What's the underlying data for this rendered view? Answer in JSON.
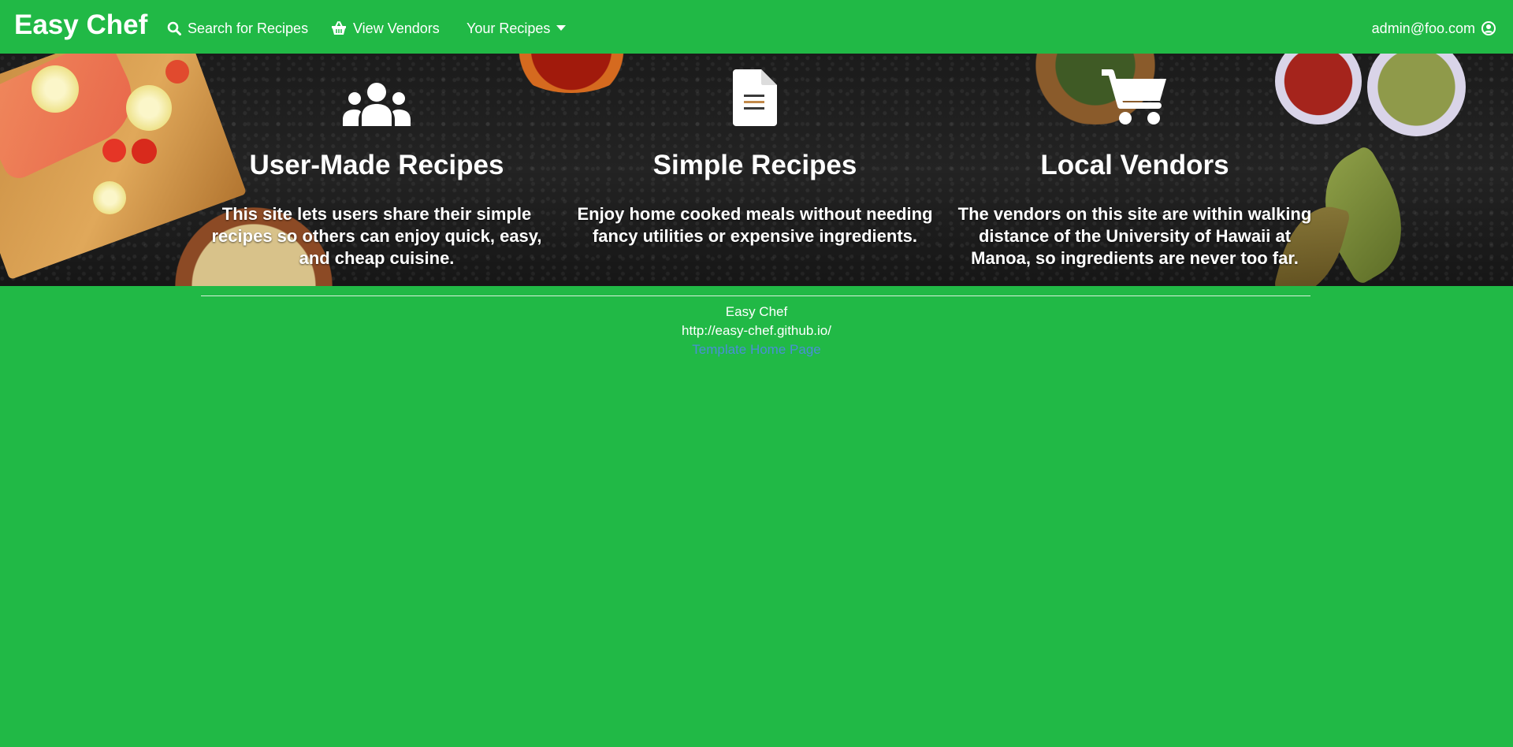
{
  "navbar": {
    "brand": "Easy Chef",
    "items": [
      {
        "label": "Search for Recipes",
        "icon": "search-icon"
      },
      {
        "label": "View Vendors",
        "icon": "basket-icon"
      },
      {
        "label": "Your Recipes",
        "icon": "caret-down-icon"
      }
    ],
    "user": {
      "label": "admin@foo.com",
      "icon": "user-circle-icon"
    }
  },
  "features": [
    {
      "icon": "users-icon",
      "title": "User-Made Recipes",
      "text": "This site lets users share their simple recipes so others can enjoy quick, easy, and cheap cuisine."
    },
    {
      "icon": "file-document-icon",
      "title": "Simple Recipes",
      "text": "Enjoy home cooked meals without needing fancy utilities or expensive ingredients."
    },
    {
      "icon": "shopping-cart-icon",
      "title": "Local Vendors",
      "text": "The vendors on this site are within walking distance of the University of Hawaii at Manoa, so ingredients are never too far."
    }
  ],
  "footer": {
    "name": "Easy Chef",
    "url": "http://easy-chef.github.io/",
    "link_label": "Template Home Page"
  },
  "colors": {
    "background": "#21b946",
    "hero_dark": "#1b1b1b",
    "link": "#4a8fd6"
  }
}
